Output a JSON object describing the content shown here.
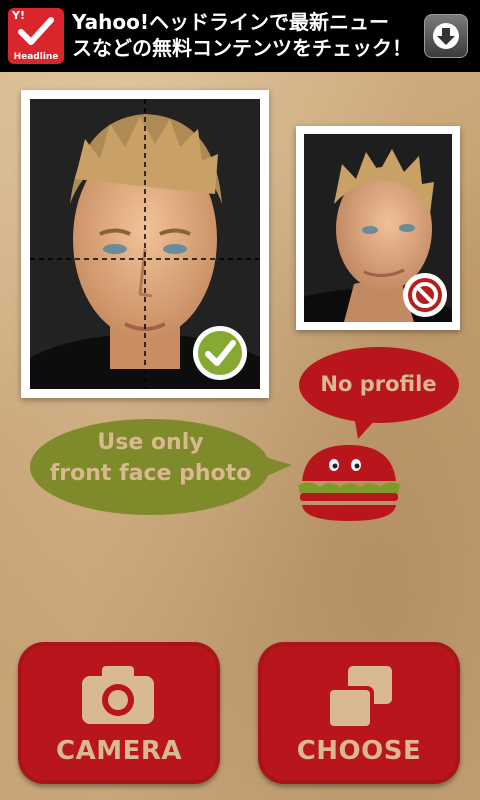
{
  "ad_banner": {
    "logo_brand": "Y!",
    "logo_caption": "Headline",
    "headline": "Yahoo!ヘッドラインで最新ニュー\nスなどの無料コンテンツをチェック！",
    "icon": "download-icon"
  },
  "photos": {
    "front": {
      "status_icon": "check-icon",
      "status": "accepted"
    },
    "profile": {
      "status_icon": "prohibited-icon",
      "status": "rejected"
    }
  },
  "bubbles": {
    "no_profile": "No profile",
    "front_face_line1": "Use only",
    "front_face_line2": "front face photo"
  },
  "mascot": {
    "icon": "burger-mascot-icon"
  },
  "buttons": {
    "camera": {
      "label": "CAMERA",
      "icon": "camera-icon"
    },
    "choose": {
      "label": "CHOOSE",
      "icon": "choose-icon"
    }
  },
  "colors": {
    "red": "#b8161c",
    "green": "#7f8a2a",
    "cream_text": "#d9b98f",
    "ad_bg": "#000000"
  }
}
